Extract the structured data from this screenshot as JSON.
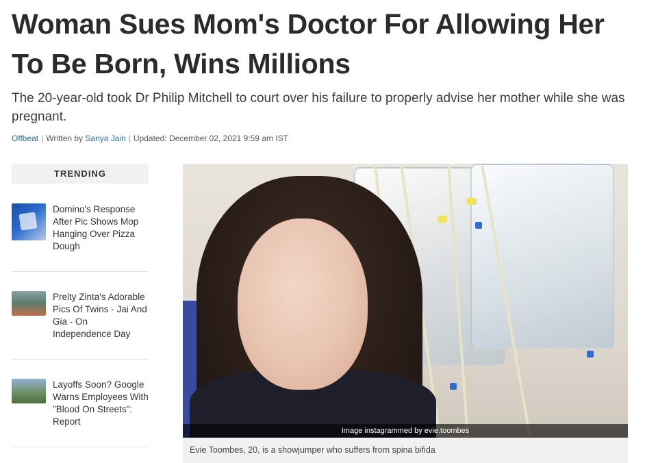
{
  "article": {
    "headline": "Woman Sues Mom's Doctor For Allowing Her To Be Born, Wins Millions",
    "subhead": "The 20-year-old took Dr Philip Mitchell to court over his failure to properly advise her mother while she was pregnant.",
    "byline": {
      "category": "Offbeat",
      "written_by_prefix": "Written by",
      "author": "Sanya Jain",
      "updated": "Updated: December 02, 2021 9:59 am IST"
    }
  },
  "trending": {
    "header": "TRENDING",
    "items": [
      {
        "title": "Domino's Response After Pic Shows Mop Hanging Over Pizza Dough",
        "thumb_icon": "pizza-photo"
      },
      {
        "title": "Preity Zinta's Adorable Pics Of Twins - Jai And Gia - On Independence Day",
        "thumb_icon": "family-photo"
      },
      {
        "title": "Layoffs Soon? Google Warns Employees With \"Blood On Streets\": Report",
        "thumb_icon": "google-office-photo"
      }
    ]
  },
  "main_image": {
    "credit": "Image instagrammed by evie.toombes",
    "caption": "Evie Toombes, 20, is a showjumper who suffers from spina bifida"
  }
}
